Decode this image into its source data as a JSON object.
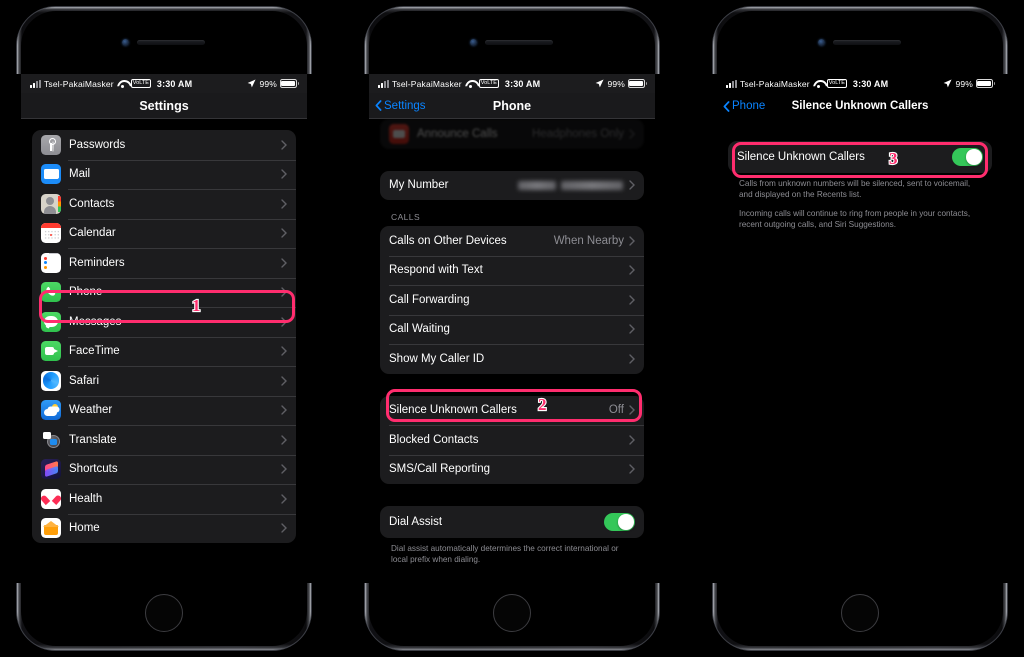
{
  "colors": {
    "highlight": "#ff2d6e",
    "accent_blue": "#0a84ff",
    "toggle_green": "#34c759",
    "row_bg": "#1c1c1e",
    "secondary_text": "#8d8d93"
  },
  "status_bar": {
    "carrier": "Tsel-PakaiMasker",
    "volte": "VoLTE",
    "time": "3:30 AM",
    "battery_percent": "99%"
  },
  "phone1": {
    "nav": {
      "title": "Settings"
    },
    "items": [
      {
        "label": "Passwords",
        "icon": "passwords-icon"
      },
      {
        "label": "Mail",
        "icon": "mail-icon"
      },
      {
        "label": "Contacts",
        "icon": "contacts-icon"
      },
      {
        "label": "Calendar",
        "icon": "calendar-icon"
      },
      {
        "label": "Reminders",
        "icon": "reminders-icon"
      },
      {
        "label": "Phone",
        "icon": "phone-icon"
      },
      {
        "label": "Messages",
        "icon": "messages-icon"
      },
      {
        "label": "FaceTime",
        "icon": "facetime-icon"
      },
      {
        "label": "Safari",
        "icon": "safari-icon"
      },
      {
        "label": "Weather",
        "icon": "weather-icon"
      },
      {
        "label": "Translate",
        "icon": "translate-icon"
      },
      {
        "label": "Shortcuts",
        "icon": "shortcuts-icon"
      },
      {
        "label": "Health",
        "icon": "health-icon"
      },
      {
        "label": "Home",
        "icon": "home-icon"
      }
    ],
    "step_badge": "1"
  },
  "phone2": {
    "nav": {
      "back": "Settings",
      "title": "Phone"
    },
    "scrolled_row": {
      "label": "Announce Calls",
      "value": "Headphones Only"
    },
    "my_number": {
      "label": "My Number",
      "value": ""
    },
    "calls_header": "CALLS",
    "calls_items": [
      {
        "label": "Calls on Other Devices",
        "value": "When Nearby"
      },
      {
        "label": "Respond with Text",
        "value": ""
      },
      {
        "label": "Call Forwarding",
        "value": ""
      },
      {
        "label": "Call Waiting",
        "value": ""
      },
      {
        "label": "Show My Caller ID",
        "value": ""
      }
    ],
    "silence_group": [
      {
        "label": "Silence Unknown Callers",
        "value": "Off"
      },
      {
        "label": "Blocked Contacts",
        "value": ""
      },
      {
        "label": "SMS/Call Reporting",
        "value": ""
      }
    ],
    "dial_assist": {
      "label": "Dial Assist",
      "enabled": true,
      "footnote": "Dial assist automatically determines the correct international or local prefix when dialing."
    },
    "step_badge": "2"
  },
  "phone3": {
    "nav": {
      "back": "Phone",
      "title": "Silence Unknown Callers"
    },
    "toggle_row": {
      "label": "Silence Unknown Callers",
      "enabled": true
    },
    "footnote1": "Calls from unknown numbers will be silenced, sent to voicemail, and displayed on the Recents list.",
    "footnote2": "Incoming calls will continue to ring from people in your contacts, recent outgoing calls, and Siri Suggestions.",
    "step_badge": "3"
  }
}
